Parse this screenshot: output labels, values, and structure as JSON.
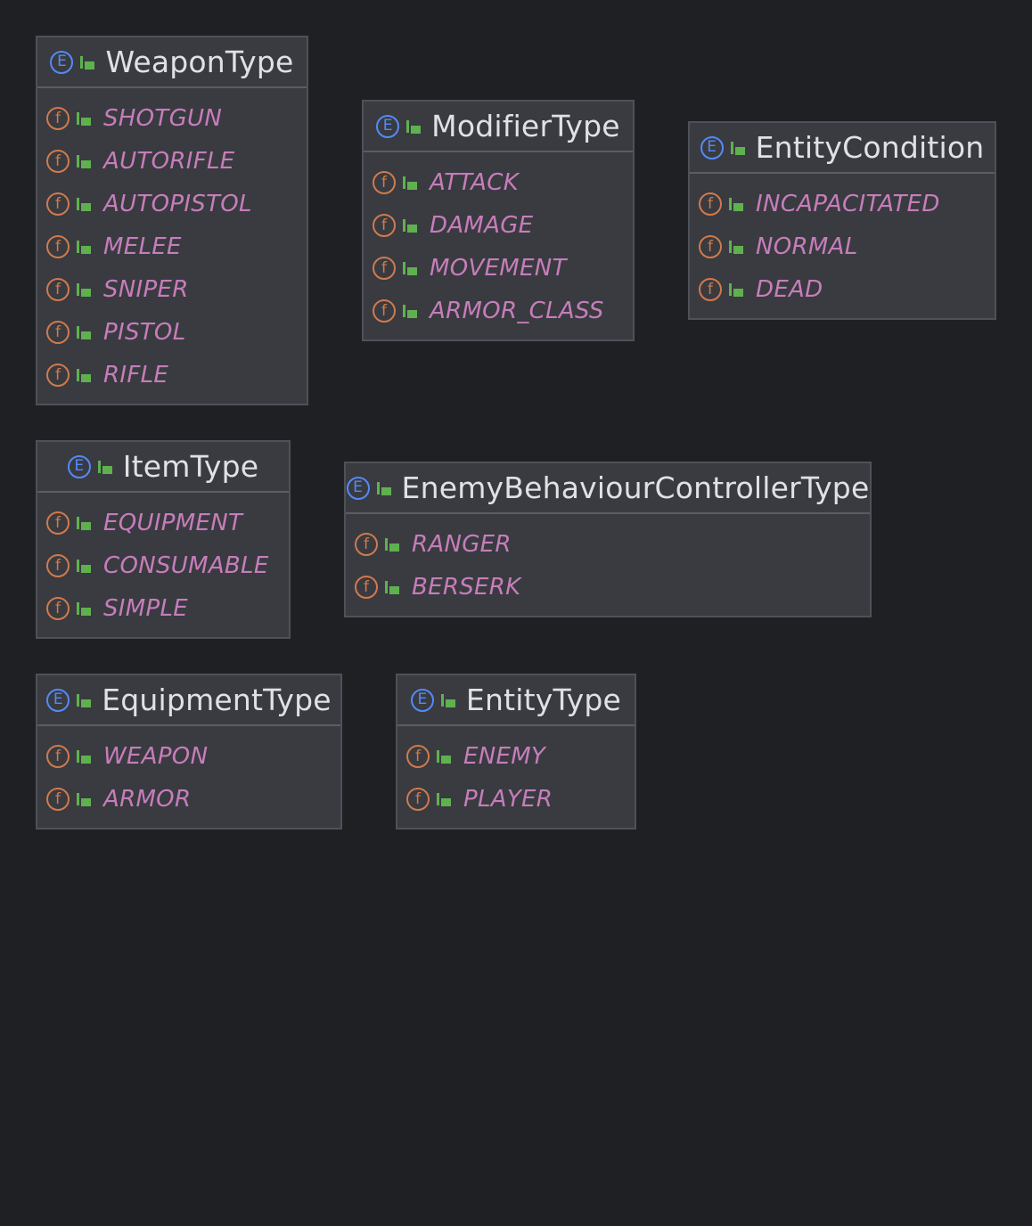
{
  "enums": [
    {
      "id": "weapon-type",
      "title": "WeaponType",
      "constants": [
        "SHOTGUN",
        "AUTORIFLE",
        "AUTOPISTOL",
        "MELEE",
        "SNIPER",
        "PISTOL",
        "RIFLE"
      ]
    },
    {
      "id": "modifier-type",
      "title": "ModifierType",
      "constants": [
        "ATTACK",
        "DAMAGE",
        "MOVEMENT",
        "ARMOR_CLASS"
      ]
    },
    {
      "id": "entity-condition",
      "title": "EntityCondition",
      "constants": [
        "INCAPACITATED",
        "NORMAL",
        "DEAD"
      ]
    },
    {
      "id": "item-type",
      "title": "ItemType",
      "constants": [
        "EQUIPMENT",
        "CONSUMABLE",
        "SIMPLE"
      ]
    },
    {
      "id": "enemy-behaviour-controller-type",
      "title": "EnemyBehaviourControllerType",
      "constants": [
        "RANGER",
        "BERSERK"
      ]
    },
    {
      "id": "equipment-type",
      "title": "EquipmentType",
      "constants": [
        "WEAPON",
        "ARMOR"
      ]
    },
    {
      "id": "entity-type",
      "title": "EntityType",
      "constants": [
        "ENEMY",
        "PLAYER"
      ]
    }
  ],
  "icons": {
    "enum_badge": "E",
    "field_badge": "f",
    "enum_icon_name": "enum-icon",
    "field_icon_name": "field-icon",
    "visibility_icon_name": "public-lock-icon"
  },
  "colors": {
    "background": "#1f2024",
    "box": "#393b40",
    "box_border": "#4e5157",
    "title_text": "#dfe1e5",
    "constant_text": "#c77dbb",
    "enum_badge": "#548af7",
    "field_badge": "#d07a4d",
    "visibility": "#5fb14f"
  }
}
